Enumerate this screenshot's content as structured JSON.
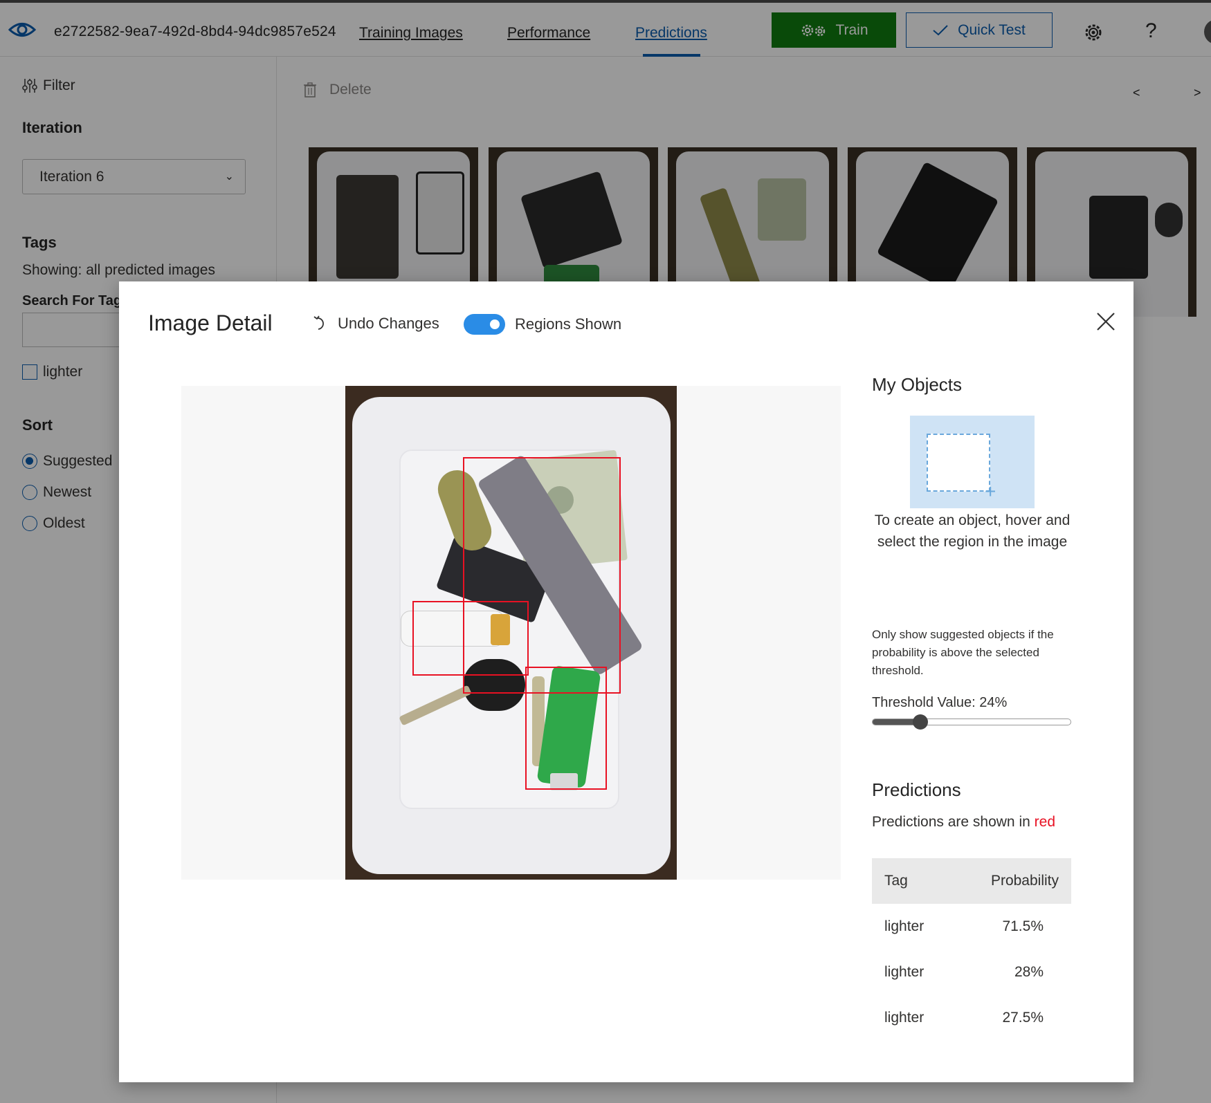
{
  "topbar": {
    "project_id": "e2722582-9ea7-492d-8bd4-94dc9857e524",
    "nav": [
      "Training Images",
      "Performance",
      "Predictions"
    ],
    "active_nav": "Predictions",
    "train_label": "Train",
    "quick_test_label": "Quick Test",
    "help_label": "?"
  },
  "sidebar": {
    "filter_label": "Filter",
    "iteration_heading": "Iteration",
    "iteration_value": "Iteration 6",
    "tags_heading": "Tags",
    "showing_text": "Showing: all predicted images",
    "search_heading": "Search For Tags",
    "tag_checkbox": "lighter",
    "sort_heading": "Sort",
    "sort_options": [
      "Suggested",
      "Newest",
      "Oldest"
    ],
    "sort_selected": "Suggested"
  },
  "gallery": {
    "delete_label": "Delete",
    "prev": "<",
    "next": ">"
  },
  "modal": {
    "title": "Image Detail",
    "undo_label": "Undo Changes",
    "regions_toggle_label": "Regions Shown",
    "regions_shown": true,
    "my_objects_heading": "My Objects",
    "create_hint": "To create an object, hover and select the region in the image",
    "threshold_text": "Only show suggested objects if the probability is above the selected threshold.",
    "threshold_label": "Threshold Value: 24%",
    "threshold_value": 0.24,
    "predictions_heading": "Predictions",
    "predictions_note_prefix": "Predictions are shown in",
    "predictions_note_color_word": "red",
    "table_headers": [
      "Tag",
      "Probability"
    ],
    "predictions": [
      {
        "tag": "lighter",
        "probability": "71.5%"
      },
      {
        "tag": "lighter",
        "probability": "28%"
      },
      {
        "tag": "lighter",
        "probability": "27.5%"
      }
    ]
  },
  "colors": {
    "accent_blue": "#0b5cad",
    "train_green": "#107c10",
    "prediction_red": "#e81123",
    "toggle_blue": "#2a8ce6"
  }
}
